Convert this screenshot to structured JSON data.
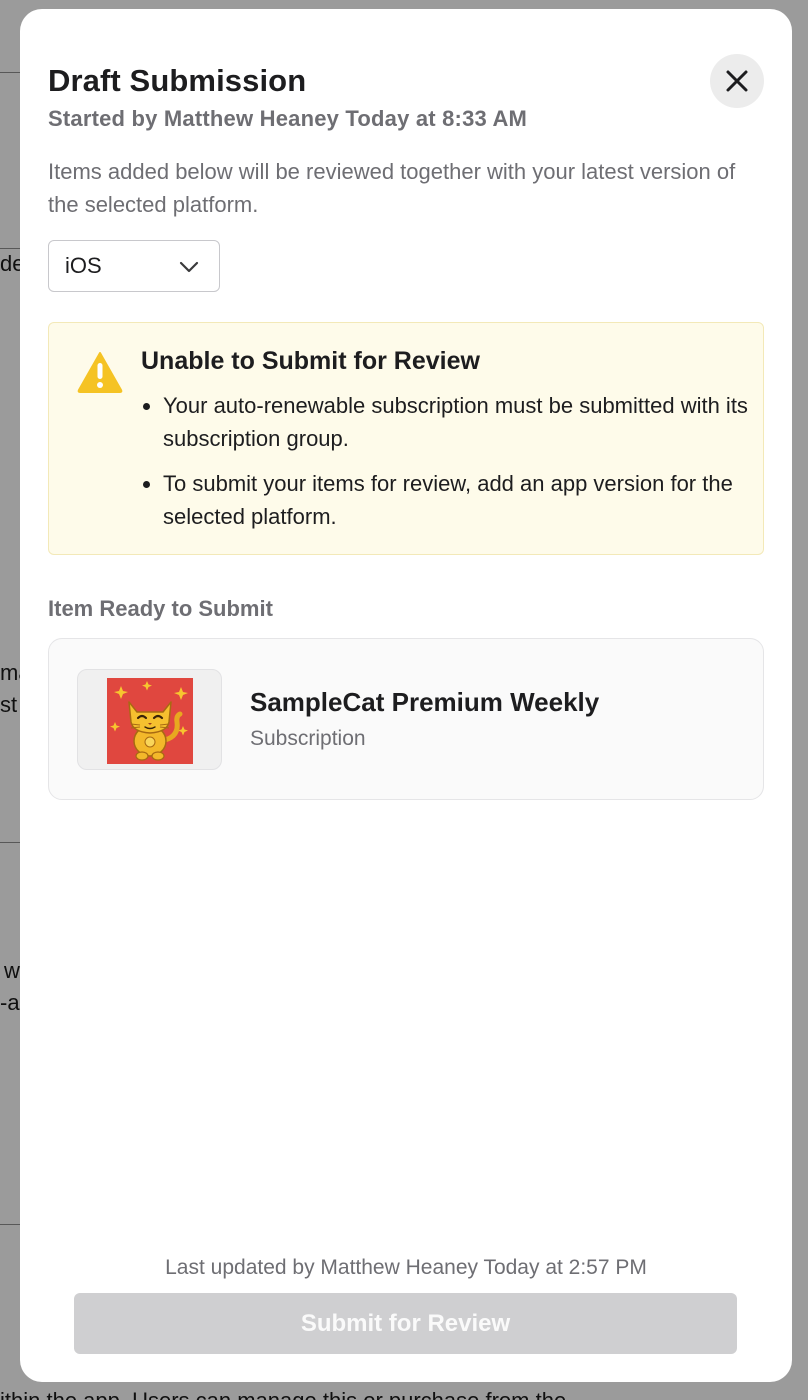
{
  "background": {
    "fragments": [
      "de",
      "ma",
      "st",
      "w",
      "-ap",
      "ithin the app. Users can manage this or purchase from the"
    ]
  },
  "modal": {
    "title": "Draft Submission",
    "subtitle": "Started by Matthew Heaney Today at 8:33 AM",
    "close_icon": "close-icon",
    "description": "Items added below will be reviewed together with your latest version of the selected platform.",
    "platform": {
      "selected": "iOS",
      "icon": "chevron-down-icon"
    },
    "warning": {
      "icon": "warning-triangle-icon",
      "title": "Unable to Submit for Review",
      "items": [
        "Your auto-renewable subscription must be submitted with its subscription group.",
        "To submit your items for review, add an app version for the selected platform."
      ]
    },
    "items_section": {
      "label": "Item Ready to Submit",
      "items": [
        {
          "name": "SampleCat Premium Weekly",
          "type": "Subscription"
        }
      ]
    },
    "footer": {
      "last_updated": "Last updated by Matthew Heaney Today at 2:57 PM",
      "submit_label": "Submit for Review"
    }
  },
  "colors": {
    "warning_bg": "#fefbea",
    "warning_icon": "#f5c324",
    "button_disabled": "#cfcfd1",
    "text_primary": "#1d1d1f",
    "text_secondary": "#6e6e73"
  }
}
